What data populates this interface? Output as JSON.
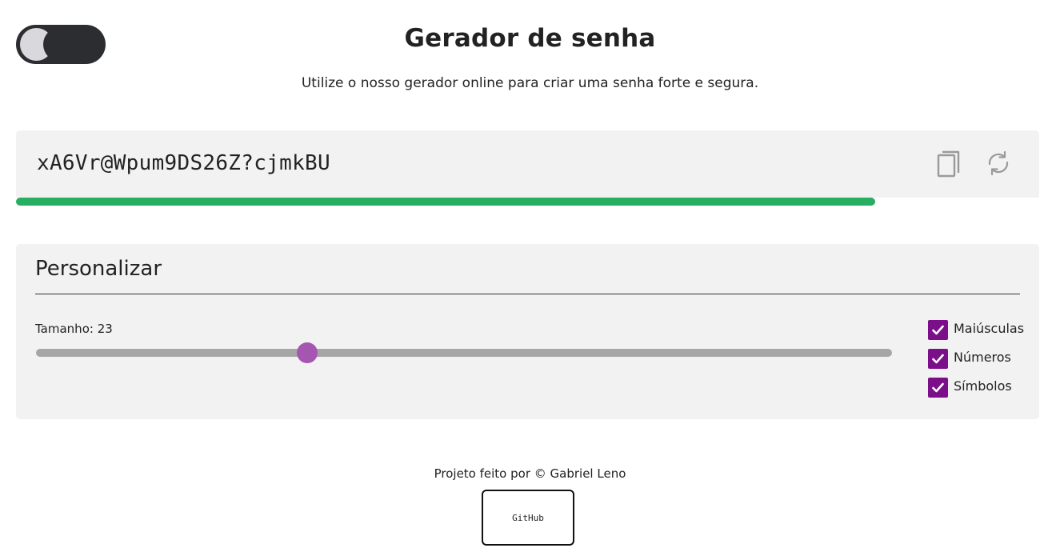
{
  "header": {
    "title": "Gerador de senha",
    "subtitle": "Utilize o nosso gerador online para criar uma senha forte e segura."
  },
  "theme_toggle": {
    "icon": "moon-icon",
    "state": "dark"
  },
  "password": {
    "value": "xA6Vr@Wpum9DS26Z?cjmkBU",
    "copy_icon": "copy-icon",
    "refresh_icon": "refresh-icon",
    "strength_fraction": 0.84,
    "strength_color": "#27ae60"
  },
  "customize": {
    "title": "Personalizar",
    "length_label": "Tamanho: 23",
    "length_value": 23,
    "length_min": 4,
    "length_max": 64,
    "accent_color": "#7b0f8a",
    "options": [
      {
        "label": "Maiúsculas",
        "checked": true
      },
      {
        "label": "Números",
        "checked": true
      },
      {
        "label": "Símbolos",
        "checked": true
      }
    ]
  },
  "footer": {
    "credit": "Projeto feito por © Gabriel Leno",
    "github_label": "GitHub"
  }
}
